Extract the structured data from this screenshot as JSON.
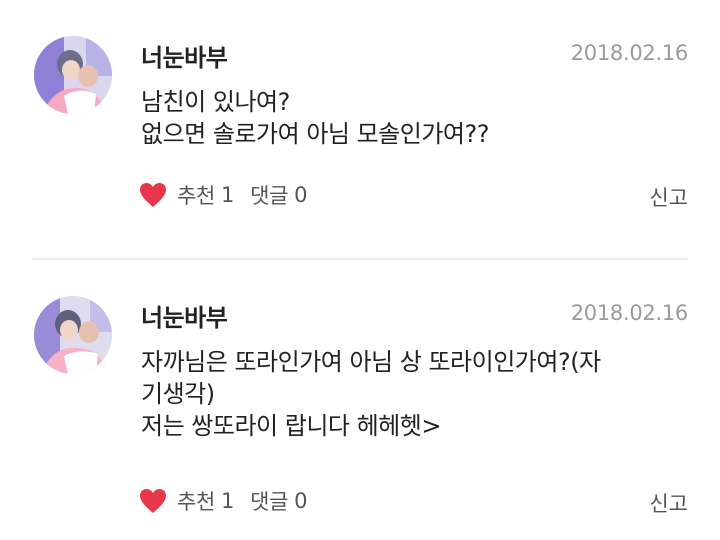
{
  "comments": [
    {
      "username": "너눈바부",
      "date": "2018.02.16",
      "lines": [
        "남친이 있나여?",
        "없으면 솔로가여 아님 모솔인가여??"
      ],
      "like_label": "추천",
      "like_count": "1",
      "reply_label": "댓글",
      "reply_count": "0",
      "report_label": "신고",
      "avatar_icon": "profile-photo"
    },
    {
      "username": "너눈바부",
      "date": "2018.02.16",
      "lines": [
        "자까님은 또라인가여 아님 상 또라이인가여?(자",
        "기생각)",
        "저는 쌍또라이 랍니다 헤헤헷>"
      ],
      "like_label": "추천",
      "like_count": "1",
      "reply_label": "댓글",
      "reply_count": "0",
      "report_label": "신고",
      "avatar_icon": "profile-photo"
    }
  ],
  "colors": {
    "heart": "#e8364a",
    "date": "#9a9a9a",
    "divider": "#ececec"
  },
  "icons": {
    "like": "heart-icon"
  }
}
